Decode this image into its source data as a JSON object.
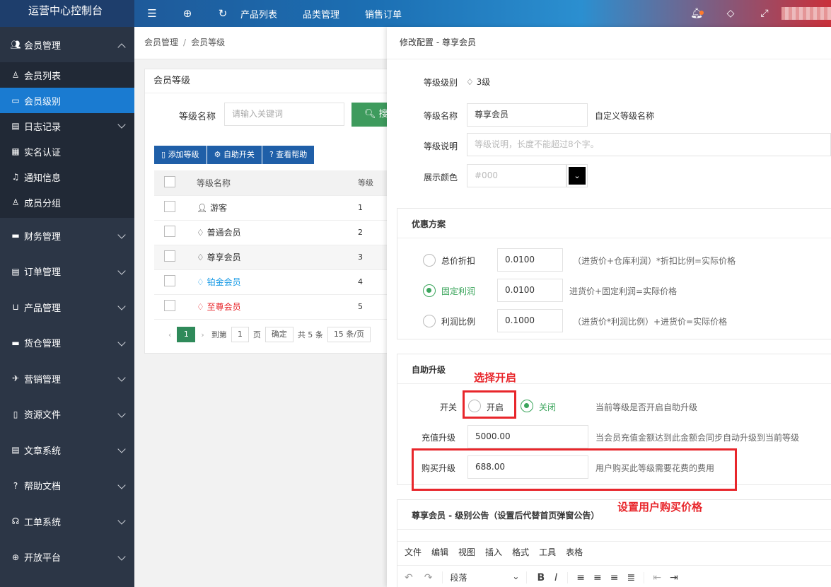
{
  "app": {
    "title": "运营中心控制台"
  },
  "topnav": {
    "links": [
      "产品列表",
      "品类管理",
      "销售订单"
    ]
  },
  "topright": {
    "user": "~wal"
  },
  "sidebar": {
    "groups": [
      {
        "label": "会员管理"
      },
      {
        "label": "财务管理"
      },
      {
        "label": "订单管理"
      },
      {
        "label": "产品管理"
      },
      {
        "label": "货仓管理"
      },
      {
        "label": "营销管理"
      },
      {
        "label": "资源文件"
      },
      {
        "label": "文章系统"
      },
      {
        "label": "帮助文档"
      },
      {
        "label": "工单系统"
      },
      {
        "label": "开放平台"
      }
    ],
    "sub": [
      "会员列表",
      "会员级别",
      "日志记录",
      "实名认证",
      "通知信息",
      "成员分组"
    ]
  },
  "breadcrumb": {
    "a": "会员管理",
    "b": "会员等级"
  },
  "panel": {
    "title": "会员等级",
    "search_label": "等级名称",
    "search_placeholder": "请输入关键词",
    "search_btn": "搜",
    "buttons": [
      "添加等级",
      "自助开关",
      "查看帮助"
    ],
    "table": {
      "headers": [
        "等级名称",
        "等级"
      ],
      "rows": [
        {
          "name": "游客",
          "level": "1",
          "color": "#333333"
        },
        {
          "name": "普通会员",
          "level": "2",
          "color": "#333333"
        },
        {
          "name": "尊享会员",
          "level": "3",
          "color": "#333333"
        },
        {
          "name": "铂金会员",
          "level": "4",
          "color": "#1a9be6"
        },
        {
          "name": "至尊会员",
          "level": "5",
          "color": "#e8262b"
        }
      ]
    },
    "pager": {
      "current": "1",
      "goto": "到第",
      "page_val": "1",
      "page": "页",
      "confirm": "确定",
      "total": "共 5 条",
      "per": "15 条/页"
    }
  },
  "drawer": {
    "title": "修改配置 - 尊享会员",
    "level_label": "等级级别",
    "level_value": "3级",
    "name_label": "等级名称",
    "name_value": "尊享会员",
    "name_hint": "自定义等级名称",
    "desc_label": "等级说明",
    "desc_placeholder": "等级说明，长度不能超过8个字。",
    "color_label": "展示颜色",
    "color_placeholder": "#000",
    "discount": {
      "title": "优惠方案",
      "options": [
        {
          "label": "总价折扣",
          "value": "0.0100",
          "hint": "（进货价+仓库利润）*折扣比例=实际价格",
          "selected": false
        },
        {
          "label": "固定利润",
          "value": "0.0100",
          "hint": "进货价+固定利润=实际价格",
          "selected": true
        },
        {
          "label": "利润比例",
          "value": "0.1000",
          "hint": "（进货价*利润比例）+进货价=实际价格",
          "selected": false
        }
      ]
    },
    "upgrade": {
      "title": "自助升级",
      "switch_label": "开关",
      "on": "开启",
      "off": "关闭",
      "switch_hint": "当前等级是否开启自助升级",
      "recharge_label": "充值升级",
      "recharge_value": "5000.00",
      "recharge_hint": "当会员充值金额达到此金额会同步自动升级到当前等级",
      "buy_label": "购买升级",
      "buy_value": "688.00",
      "buy_hint": "用户购买此等级需要花费的费用"
    },
    "notice": {
      "title": "尊享会员 - 级别公告（设置后代替首页弹窗公告）",
      "menu": [
        "文件",
        "编辑",
        "视图",
        "插入",
        "格式",
        "工具",
        "表格"
      ],
      "paragraph": "段落"
    },
    "annotations": {
      "a1": "选择开启",
      "a2": "设置用户购买价格"
    }
  }
}
